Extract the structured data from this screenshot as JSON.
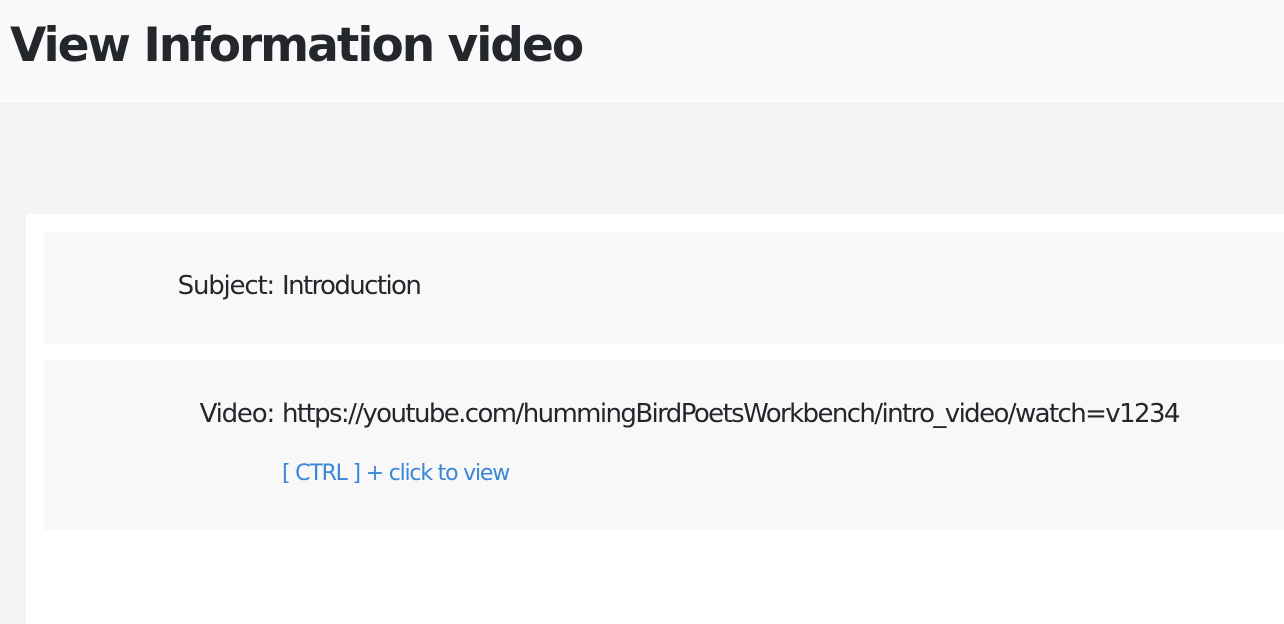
{
  "header": {
    "title": "View Information video"
  },
  "details": {
    "subject": {
      "label": "Subject:",
      "value": "Introduction"
    },
    "video": {
      "label": "Video:",
      "value": "https://youtube.com/hummingBirdPoetsWorkbench/intro_video/watch=v1234",
      "hint": "[ CTRL ] + click to view"
    }
  },
  "colors": {
    "link": "#3a86d8",
    "text": "#23262b",
    "header_bg": "#f9f9f9",
    "page_bg": "#f4f4f4",
    "panel_bg": "#ffffff",
    "row_bg": "#f8f8f8"
  }
}
